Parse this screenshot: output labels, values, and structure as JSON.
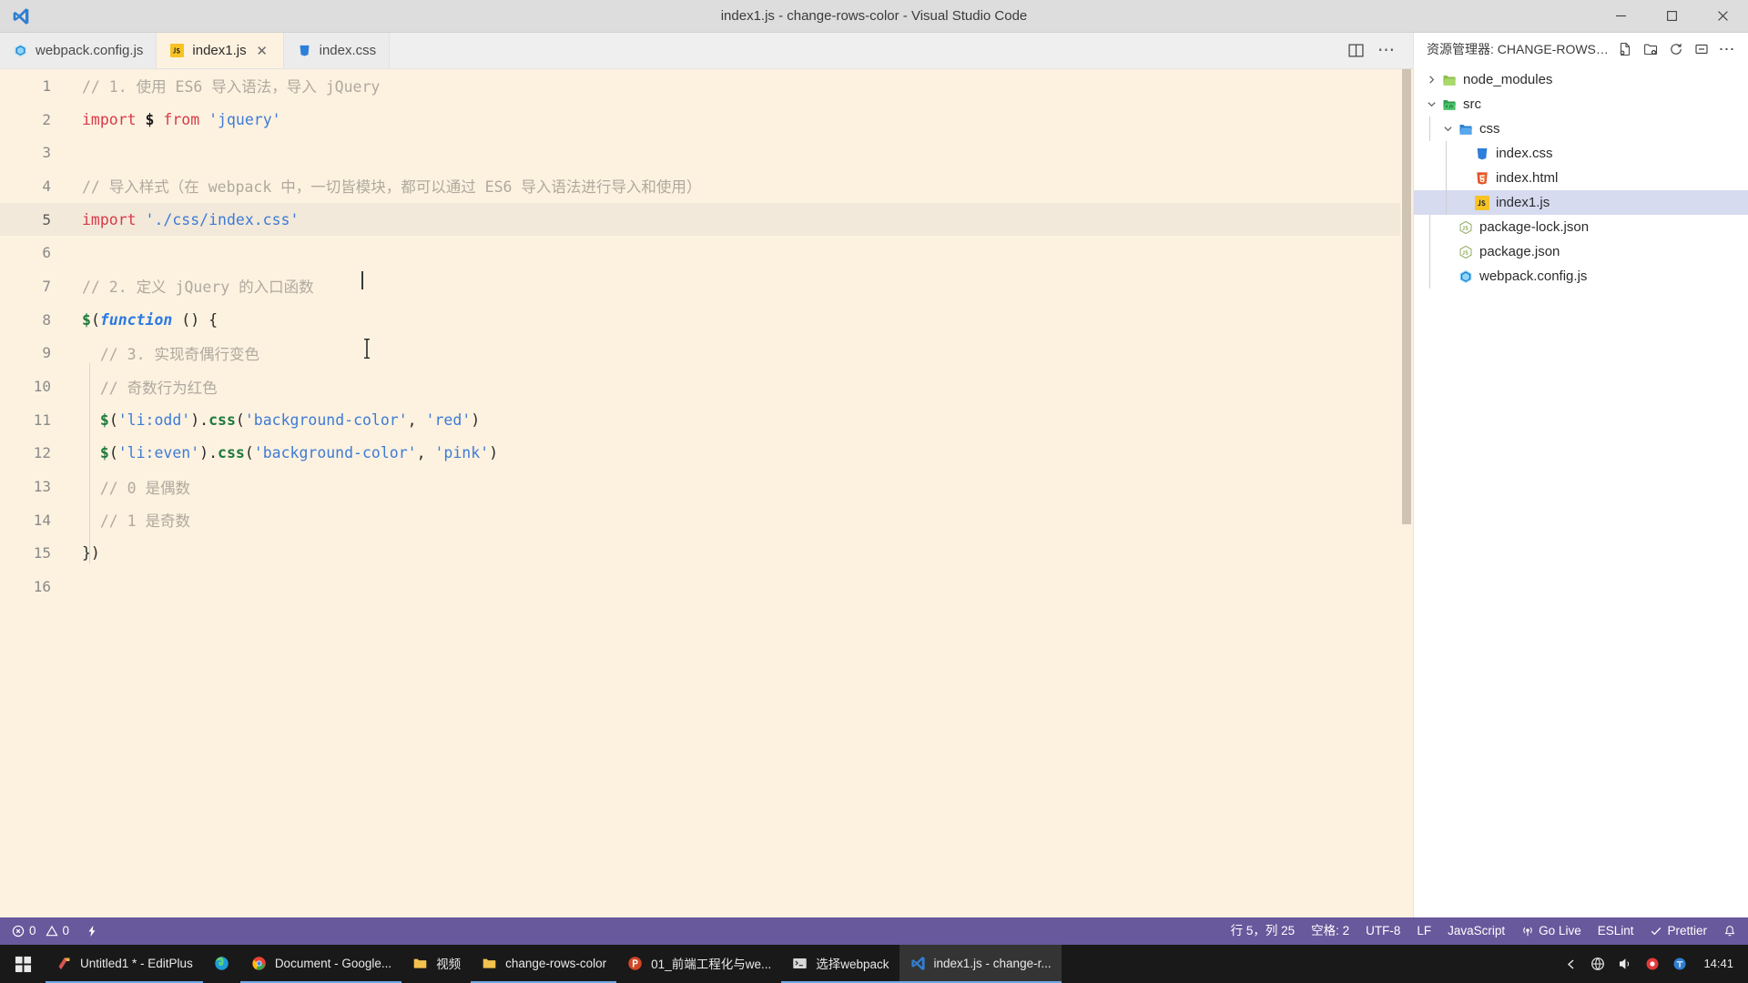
{
  "window": {
    "title": "index1.js - change-rows-color - Visual Studio Code",
    "logo": "vscode-logo",
    "controls": {
      "minimize": "minimize-button",
      "maximize": "maximize-button",
      "close": "close-button"
    }
  },
  "tabs": {
    "items": [
      {
        "label": "webpack.config.js",
        "icon": "webpack-icon",
        "active": false,
        "closable": false
      },
      {
        "label": "index1.js",
        "icon": "javascript-icon",
        "active": true,
        "closable": true,
        "close_glyph": "✕"
      },
      {
        "label": "index.css",
        "icon": "css-icon",
        "active": false,
        "closable": false
      }
    ],
    "actions": [
      {
        "name": "split-editor-icon"
      },
      {
        "name": "more-actions-icon",
        "glyph": "⋯"
      }
    ]
  },
  "editor": {
    "lines": [
      {
        "n": "1",
        "current": false,
        "tokens": [
          {
            "t": "// 1. 使用 ES6 导入语法，导入 jQuery",
            "c": "tok-comment"
          }
        ]
      },
      {
        "n": "2",
        "current": false,
        "tokens": [
          {
            "t": "import",
            "c": "tok-kw"
          },
          {
            "t": " ",
            "c": "tok-punc"
          },
          {
            "t": "$",
            "c": "tok-var"
          },
          {
            "t": " ",
            "c": "tok-punc"
          },
          {
            "t": "from",
            "c": "tok-kw"
          },
          {
            "t": " ",
            "c": "tok-punc"
          },
          {
            "t": "'jquery'",
            "c": "tok-str"
          }
        ]
      },
      {
        "n": "3",
        "current": false,
        "tokens": []
      },
      {
        "n": "4",
        "current": false,
        "tokens": [
          {
            "t": "// 导入样式（在 webpack 中，一切皆模块，都可以通过 ES6 导入语法进行导入和使用）",
            "c": "tok-comment"
          }
        ]
      },
      {
        "n": "5",
        "current": true,
        "tokens": [
          {
            "t": "import",
            "c": "tok-kw"
          },
          {
            "t": " ",
            "c": "tok-punc"
          },
          {
            "t": "'./css/index.css'",
            "c": "tok-str"
          }
        ]
      },
      {
        "n": "6",
        "current": false,
        "tokens": []
      },
      {
        "n": "7",
        "current": false,
        "tokens": [
          {
            "t": "// 2. 定义 jQuery 的入口函数",
            "c": "tok-comment"
          }
        ]
      },
      {
        "n": "8",
        "current": false,
        "tokens": [
          {
            "t": "$",
            "c": "tok-green"
          },
          {
            "t": "(",
            "c": "tok-punc"
          },
          {
            "t": "function",
            "c": "tok-fn"
          },
          {
            "t": " () {",
            "c": "tok-punc"
          }
        ]
      },
      {
        "n": "9",
        "current": false,
        "tokens": [
          {
            "t": "  // 3. 实现奇偶行变色",
            "c": "tok-comment"
          }
        ]
      },
      {
        "n": "10",
        "current": false,
        "tokens": [
          {
            "t": "  // 奇数行为红色",
            "c": "tok-comment"
          }
        ]
      },
      {
        "n": "11",
        "current": false,
        "tokens": [
          {
            "t": "  ",
            "c": "tok-punc"
          },
          {
            "t": "$",
            "c": "tok-green"
          },
          {
            "t": "(",
            "c": "tok-punc"
          },
          {
            "t": "'li:odd'",
            "c": "tok-str"
          },
          {
            "t": ")",
            "c": "tok-punc"
          },
          {
            "t": ".",
            "c": "tok-punc"
          },
          {
            "t": "css",
            "c": "tok-green"
          },
          {
            "t": "(",
            "c": "tok-punc"
          },
          {
            "t": "'background-color'",
            "c": "tok-str"
          },
          {
            "t": ", ",
            "c": "tok-punc"
          },
          {
            "t": "'red'",
            "c": "tok-str"
          },
          {
            "t": ")",
            "c": "tok-punc"
          }
        ]
      },
      {
        "n": "12",
        "current": false,
        "tokens": [
          {
            "t": "  ",
            "c": "tok-punc"
          },
          {
            "t": "$",
            "c": "tok-green"
          },
          {
            "t": "(",
            "c": "tok-punc"
          },
          {
            "t": "'li:even'",
            "c": "tok-str"
          },
          {
            "t": ")",
            "c": "tok-punc"
          },
          {
            "t": ".",
            "c": "tok-punc"
          },
          {
            "t": "css",
            "c": "tok-green"
          },
          {
            "t": "(",
            "c": "tok-punc"
          },
          {
            "t": "'background-color'",
            "c": "tok-str"
          },
          {
            "t": ", ",
            "c": "tok-punc"
          },
          {
            "t": "'pink'",
            "c": "tok-str"
          },
          {
            "t": ")",
            "c": "tok-punc"
          }
        ]
      },
      {
        "n": "13",
        "current": false,
        "tokens": [
          {
            "t": "  // 0 是偶数",
            "c": "tok-comment"
          }
        ]
      },
      {
        "n": "14",
        "current": false,
        "tokens": [
          {
            "t": "  // 1 是奇数",
            "c": "tok-comment"
          }
        ]
      },
      {
        "n": "15",
        "current": false,
        "tokens": [
          {
            "t": "})",
            "c": "tok-punc"
          }
        ]
      },
      {
        "n": "16",
        "current": false,
        "tokens": []
      }
    ]
  },
  "sidebar": {
    "title": "资源管理器: CHANGE-ROWS-COLOR",
    "actions": [
      {
        "name": "new-file-icon"
      },
      {
        "name": "new-folder-icon"
      },
      {
        "name": "refresh-icon"
      },
      {
        "name": "collapse-all-icon"
      },
      {
        "name": "views-more-actions-icon",
        "glyph": "⋯"
      }
    ],
    "tree": [
      {
        "label": "node_modules",
        "icon": "folder-icon",
        "twisty": "chevron-right-icon",
        "depth": 0,
        "selected": false
      },
      {
        "label": "src",
        "icon": "folder-src-icon",
        "twisty": "chevron-down-icon",
        "depth": 0,
        "selected": false
      },
      {
        "label": "css",
        "icon": "folder-css-icon",
        "twisty": "chevron-down-icon",
        "depth": 1,
        "selected": false
      },
      {
        "label": "index.css",
        "icon": "css-icon",
        "twisty": "",
        "depth": 2,
        "selected": false
      },
      {
        "label": "index.html",
        "icon": "html-icon",
        "twisty": "",
        "depth": 2,
        "selected": false
      },
      {
        "label": "index1.js",
        "icon": "javascript-icon",
        "twisty": "",
        "depth": 2,
        "selected": true
      },
      {
        "label": "package-lock.json",
        "icon": "nodejs-icon",
        "twisty": "",
        "depth": 1,
        "selected": false
      },
      {
        "label": "package.json",
        "icon": "nodejs-icon",
        "twisty": "",
        "depth": 1,
        "selected": false
      },
      {
        "label": "webpack.config.js",
        "icon": "webpack-icon",
        "twisty": "",
        "depth": 1,
        "selected": false
      }
    ]
  },
  "statusbar": {
    "errors": "0",
    "warnings": "0",
    "ports_icon": "remote-ports-icon",
    "cursor_position": "行 5，列 25",
    "indentation": "空格: 2",
    "encoding": "UTF-8",
    "eol": "LF",
    "language": "JavaScript",
    "golive": "Go Live",
    "eslint": "ESLint",
    "prettier": "Prettier",
    "notifications_icon": "bell-icon"
  },
  "taskbar": {
    "start": "windows-start-icon",
    "items": [
      {
        "label": "Untitled1 * - EditPlus",
        "icon": "editplus-icon",
        "active": false,
        "underline": true
      },
      {
        "label": "",
        "icon": "edge-dev-icon",
        "active": false,
        "underline": false
      },
      {
        "label": "Document - Google...",
        "icon": "chrome-icon",
        "active": false,
        "underline": true
      },
      {
        "label": "视频",
        "icon": "folder-icon",
        "active": false,
        "underline": false
      },
      {
        "label": "change-rows-color",
        "icon": "folder-icon",
        "active": false,
        "underline": true
      },
      {
        "label": "01_前端工程化与we...",
        "icon": "powerpoint-icon",
        "active": false,
        "underline": false
      },
      {
        "label": "选择webpack",
        "icon": "terminal-icon",
        "active": false,
        "underline": true
      },
      {
        "label": "index1.js - change-r...",
        "icon": "vscode-icon",
        "active": true,
        "underline": true
      }
    ],
    "tray": [
      {
        "name": "show-hidden-icons-icon"
      },
      {
        "name": "network-icon"
      },
      {
        "name": "volume-icon"
      },
      {
        "name": "recording-icon"
      },
      {
        "name": "input-method-icon"
      }
    ],
    "clock_time": "14:41"
  }
}
